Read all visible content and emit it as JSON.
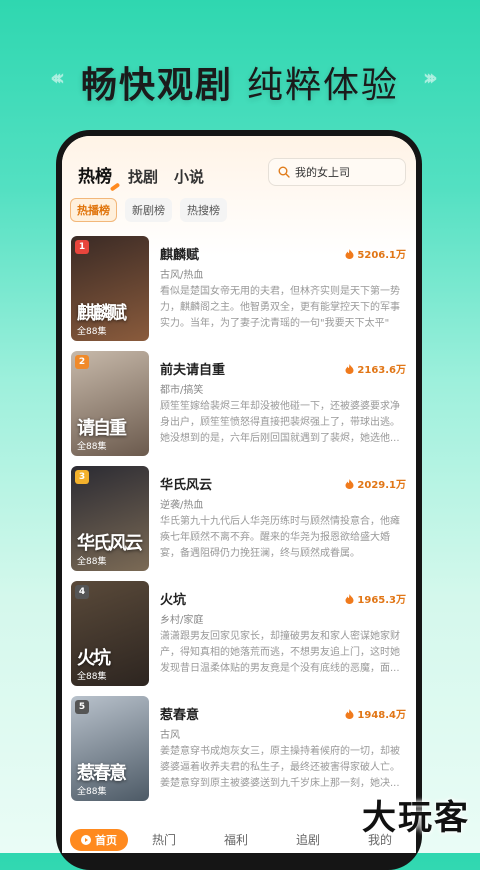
{
  "promo": {
    "headline_part1": "畅快观剧",
    "headline_part2": "纯粹体验"
  },
  "top_tabs": [
    {
      "label": "热榜",
      "active": true
    },
    {
      "label": "找剧",
      "active": false
    },
    {
      "label": "小说",
      "active": false
    }
  ],
  "search": {
    "text": "我的女上司",
    "icon": "search-icon"
  },
  "sub_tabs": [
    {
      "label": "热播榜",
      "active": true
    },
    {
      "label": "新剧榜",
      "active": false
    },
    {
      "label": "热搜榜",
      "active": false
    }
  ],
  "dramas": [
    {
      "rank": "1",
      "title": "麒麟赋",
      "poster_text": "麒麟赋",
      "episodes": "全88集",
      "heat": "5206.1万",
      "tags": "古风/热血",
      "description": "看似是楚国女帝无用的夫君，但林齐实则是天下第一势力，麒麟阁之主。他智勇双全，更有能掌控天下的军事实力。当年，为了妻子沈青瑶的一句\"我要天下太平\"",
      "rank_color": "#e8453c",
      "poster_colors": [
        "#3a2a25",
        "#8a5b3c"
      ]
    },
    {
      "rank": "2",
      "title": "前夫请自重",
      "poster_text": "请自重",
      "episodes": "全88集",
      "heat": "2163.6万",
      "tags": "都市/搞笑",
      "description": "顾笙笙嫁给裴烬三年却没被他碰一下，还被婆婆要求净身出户，顾笙笙愤怒得直接把裴烬强上了，带球出逃。她没想到的是，六年后刚回国就遇到了裴烬，她选他...",
      "rank_color": "#f08a2a",
      "poster_colors": [
        "#c7b9aa",
        "#6b5a4d"
      ]
    },
    {
      "rank": "3",
      "title": "华氏风云",
      "poster_text": "华氏风云",
      "episodes": "全88集",
      "heat": "2029.1万",
      "tags": "逆袭/热血",
      "description": "华氏第九十九代后人华尧历练时与顾然情投意合，他瘫痪七年顾然不离不弃。醒来的华尧为报恩欲给盛大婚宴，备遇阻碍仍力挽狂澜，终与顾然成眷属。",
      "rank_color": "#f3b12c",
      "poster_colors": [
        "#2b2b33",
        "#7b6a55"
      ]
    },
    {
      "rank": "4",
      "title": "火坑",
      "poster_text": "火坑",
      "episodes": "全88集",
      "heat": "1965.3万",
      "tags": "乡村/家庭",
      "description": "潇潇跟男友回家见家长，却撞破男友和家人密谋她家财产，得知真相的她落荒而逃，不想男友追上门，这时她发现昔日温柔体贴的男友竟是个没有底线的恶魔，面...",
      "rank_color": "#555555",
      "poster_colors": [
        "#5a4a3a",
        "#2d2520"
      ]
    },
    {
      "rank": "5",
      "title": "惹春意",
      "poster_text": "惹春意",
      "episodes": "全88集",
      "heat": "1948.4万",
      "tags": "古风",
      "description": "姜楚意穿书成炮灰女三，原主操持着候府的一切，却被婆婆逼着收养夫君的私生子，最终还被害得家破人亡。姜楚意穿到原主被婆婆送到九千岁床上那一刻，她决...",
      "rank_color": "#555555",
      "poster_colors": [
        "#b9c2cc",
        "#4d5a66"
      ]
    }
  ],
  "bottom_nav": [
    {
      "label": "首页",
      "active": true
    },
    {
      "label": "热门",
      "active": false
    },
    {
      "label": "福利",
      "active": false
    },
    {
      "label": "追剧",
      "active": false
    },
    {
      "label": "我的",
      "active": false
    }
  ],
  "watermark": "大玩客",
  "colors": {
    "accent": "#ff8a1f",
    "heat": "#e17616",
    "bg_top": "#2fd7b0"
  }
}
